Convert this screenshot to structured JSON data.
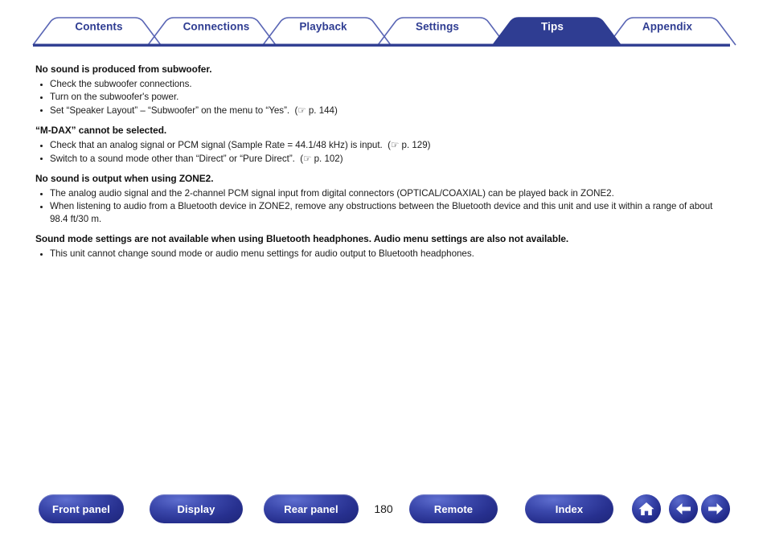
{
  "tabs": [
    {
      "label": "Contents",
      "active": false
    },
    {
      "label": "Connections",
      "active": false
    },
    {
      "label": "Playback",
      "active": false
    },
    {
      "label": "Settings",
      "active": false
    },
    {
      "label": "Tips",
      "active": true
    },
    {
      "label": "Appendix",
      "active": false
    }
  ],
  "colors": {
    "tab_border": "#5a66b5",
    "tab_active_fill": "#2f3d92",
    "rule": "#2f3d92",
    "accent": "#2f3d92",
    "text": "#1a1a1a"
  },
  "sections": [
    {
      "heading": "No sound is produced from subwoofer.",
      "bullets": [
        {
          "text": "Check the subwoofer connections.",
          "ref": ""
        },
        {
          "text": "Turn on the subwoofer's power.",
          "ref": ""
        },
        {
          "text": "Set “Speaker Layout” – “Subwoofer” on the menu to “Yes”.",
          "ref": "p. 144"
        }
      ]
    },
    {
      "heading": "“M-DAX” cannot be selected.",
      "bullets": [
        {
          "text": "Check that an analog signal or PCM signal (Sample Rate = 44.1/48 kHz) is input.",
          "ref": "p. 129"
        },
        {
          "text": "Switch to a sound mode other than “Direct” or “Pure Direct”.",
          "ref": "p. 102"
        }
      ]
    },
    {
      "heading": "No sound is output when using ZONE2.",
      "bullets": [
        {
          "text": "The analog audio signal and the 2-channel PCM signal input from digital connectors (OPTICAL/COAXIAL) can be played back in ZONE2.",
          "ref": ""
        },
        {
          "text": "When listening to audio from a Bluetooth device in ZONE2, remove any obstructions between the Bluetooth device and this unit and use it within a range of about 98.4 ft/30 m.",
          "ref": ""
        }
      ]
    },
    {
      "heading": "Sound mode settings are not available when using Bluetooth headphones. Audio menu settings are also not available.",
      "bullets": [
        {
          "text": "This unit cannot change sound mode or audio menu settings for audio output to Bluetooth headphones.",
          "ref": ""
        }
      ]
    }
  ],
  "footer": {
    "page_number": "180",
    "buttons": [
      {
        "label": "Front panel"
      },
      {
        "label": "Display"
      },
      {
        "label": "Rear panel"
      },
      {
        "label": "Remote"
      },
      {
        "label": "Index"
      }
    ],
    "icons": [
      {
        "name": "home-icon"
      },
      {
        "name": "back-arrow-icon"
      },
      {
        "name": "forward-arrow-icon"
      }
    ]
  },
  "pageref_glyph": "☞"
}
